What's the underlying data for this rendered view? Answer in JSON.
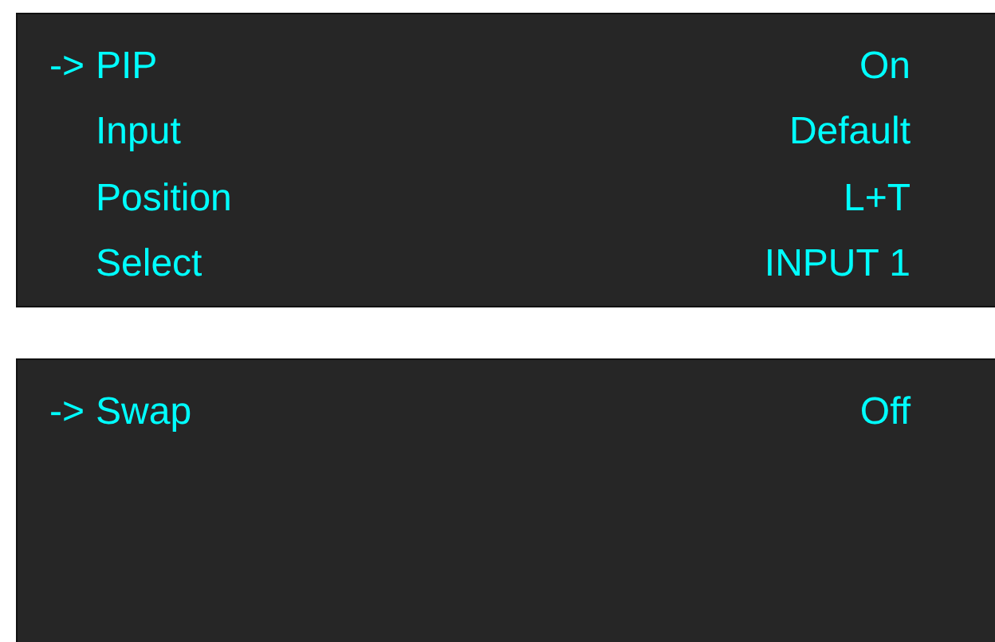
{
  "panels": [
    {
      "cursor": "->",
      "rows": [
        {
          "label": "PIP",
          "value": "On",
          "selected": true
        },
        {
          "label": "Input",
          "value": "Default",
          "selected": false
        },
        {
          "label": "Position",
          "value": "L+T",
          "selected": false
        },
        {
          "label": "Select",
          "value": "INPUT 1",
          "selected": false
        }
      ]
    },
    {
      "cursor": "->",
      "rows": [
        {
          "label": "Swap",
          "value": "Off",
          "selected": true
        }
      ]
    }
  ]
}
